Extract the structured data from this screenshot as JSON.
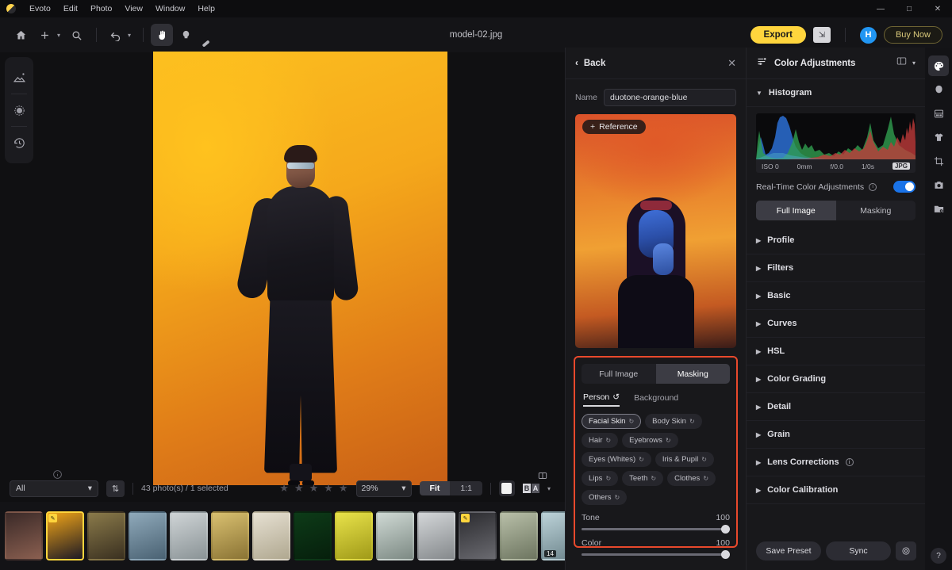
{
  "app": {
    "name": "Evoto",
    "document_title": "model-02.jpg"
  },
  "menubar": {
    "items": [
      "Evoto",
      "Edit",
      "Photo",
      "View",
      "Window",
      "Help"
    ],
    "window_controls": [
      "minimize",
      "maximize",
      "close"
    ]
  },
  "toolbar": {
    "tools": [
      {
        "name": "home-icon",
        "label": "Home"
      },
      {
        "name": "add-icon",
        "label": "Add"
      },
      {
        "name": "chevron-down-icon",
        "label": "Add options"
      },
      {
        "name": "search-icon",
        "label": "Search"
      },
      {
        "name": "undo-icon",
        "label": "Undo"
      },
      {
        "name": "chevron-down-icon",
        "label": "History"
      },
      {
        "name": "hand-icon",
        "label": "Pan",
        "active": true
      },
      {
        "name": "dodge-icon",
        "label": "Dodge"
      },
      {
        "name": "healing-brush-icon",
        "label": "Healing Brush"
      }
    ],
    "export_label": "Export",
    "share_label": "Share",
    "avatar_initial": "H",
    "buy_label": "Buy Now",
    "accent_yellow": "#ffd53d",
    "avatar_color": "#2196f3"
  },
  "left_rail": {
    "items": [
      {
        "name": "image-adjust-icon",
        "label": "Image"
      },
      {
        "name": "presets-icon",
        "label": "Presets"
      },
      {
        "name": "history-icon",
        "label": "History"
      }
    ]
  },
  "canvas": {
    "info_icon": "info-icon",
    "split_view_icon": "split-view-icon"
  },
  "bottom_bar": {
    "filter_value": "All",
    "sort_icon": "sort-icon",
    "count_text": "43 photo(s) / 1 selected",
    "stars": 5,
    "zoom_value": "29%",
    "fit_label": "Fit",
    "one_to_one_label": "1:1",
    "background_swatch": "#f2f2f2",
    "compare_icon": "before-after-icon"
  },
  "filmstrip": {
    "thumbnails": [
      {
        "c1": "#3b2a28",
        "c2": "#8a5f50",
        "selected": false,
        "edited": false
      },
      {
        "c1": "#f0a418",
        "c2": "#1d1a24",
        "selected": true,
        "edited": true
      },
      {
        "c1": "#8a7a4a",
        "c2": "#3a3020",
        "selected": false,
        "edited": false
      },
      {
        "c1": "#8fa9ba",
        "c2": "#4a6273",
        "selected": false,
        "edited": false
      },
      {
        "c1": "#cfd4d6",
        "c2": "#8a9396",
        "selected": false,
        "edited": false
      },
      {
        "c1": "#d9c070",
        "c2": "#8a7334",
        "selected": false,
        "edited": false
      },
      {
        "c1": "#e6e0d2",
        "c2": "#b0a890",
        "selected": false,
        "edited": false
      },
      {
        "c1": "#0d3b18",
        "c2": "#061f0c",
        "selected": false,
        "edited": false
      },
      {
        "c1": "#e8e24a",
        "c2": "#a09a18",
        "selected": false,
        "edited": false
      },
      {
        "c1": "#cfd9d4",
        "c2": "#7d8a84",
        "selected": false,
        "edited": false
      },
      {
        "c1": "#d3d6d8",
        "c2": "#85898c",
        "selected": false,
        "edited": false
      },
      {
        "c1": "#2b2b2f",
        "c2": "#6a6a70",
        "selected": false,
        "edited": true
      },
      {
        "c1": "#b8bfa8",
        "c2": "#6d7560",
        "selected": false,
        "edited": false
      },
      {
        "c1": "#bcd2d8",
        "c2": "#6d858c",
        "selected": false,
        "edited": false,
        "badge": "14"
      },
      {
        "c1": "#c9c3bb",
        "c2": "#7a736b",
        "selected": false,
        "edited": false
      },
      {
        "c1": "#7b3fa8",
        "c2": "#3a1c54",
        "selected": false,
        "edited": true
      }
    ]
  },
  "preset_panel": {
    "back_label": "Back",
    "close_icon": "close-icon",
    "name_label": "Name",
    "name_value": "duotone-orange-blue",
    "reference_label": "Reference",
    "mask_highlight_color": "#e8492c",
    "mode_tabs": [
      {
        "label": "Full Image",
        "active": false
      },
      {
        "label": "Masking",
        "active": true
      }
    ],
    "subject_tabs": [
      {
        "label": "Person",
        "active": true
      },
      {
        "label": "Background",
        "active": false
      }
    ],
    "chips": [
      {
        "label": "Facial Skin",
        "selected": true
      },
      {
        "label": "Body Skin",
        "selected": false
      },
      {
        "label": "Hair",
        "selected": false
      },
      {
        "label": "Eyebrows",
        "selected": false
      },
      {
        "label": "Eyes (Whites)",
        "selected": false
      },
      {
        "label": "Iris & Pupil",
        "selected": false
      },
      {
        "label": "Lips",
        "selected": false
      },
      {
        "label": "Teeth",
        "selected": false
      },
      {
        "label": "Clothes",
        "selected": false
      },
      {
        "label": "Others",
        "selected": false
      }
    ],
    "sliders": [
      {
        "label": "Tone",
        "value": "100",
        "percent": 100
      },
      {
        "label": "Color",
        "value": "100",
        "percent": 100
      }
    ]
  },
  "adjustments_panel": {
    "title": "Color Adjustments",
    "layout_icon": "panel-layout-icon",
    "chevron_icon": "chevron-down-icon",
    "histogram": {
      "label": "Histogram",
      "meta": {
        "iso": "ISO 0",
        "focal": "0mm",
        "aperture": "f/0.0",
        "shutter": "1/0s",
        "format": "JPG"
      }
    },
    "realtime": {
      "label": "Real-Time Color Adjustments",
      "enabled": true,
      "toggle_color": "#1a73e8"
    },
    "mode_tabs": [
      {
        "label": "Full Image",
        "active": true
      },
      {
        "label": "Masking",
        "active": false
      }
    ],
    "sections": [
      {
        "label": "Profile",
        "info": false
      },
      {
        "label": "Filters",
        "info": false
      },
      {
        "label": "Basic",
        "info": false
      },
      {
        "label": "Curves",
        "info": false
      },
      {
        "label": "HSL",
        "info": false
      },
      {
        "label": "Color Grading",
        "info": false
      },
      {
        "label": "Detail",
        "info": false
      },
      {
        "label": "Grain",
        "info": false
      },
      {
        "label": "Lens Corrections",
        "info": true
      },
      {
        "label": "Color Calibration",
        "info": false
      }
    ],
    "footer": {
      "save_preset_label": "Save Preset",
      "sync_label": "Sync",
      "settings_icon": "gear-icon"
    }
  },
  "right_rail": {
    "items": [
      {
        "name": "palette-icon",
        "label": "Color",
        "active": true
      },
      {
        "name": "face-icon",
        "label": "Retouch"
      },
      {
        "name": "texture-icon",
        "label": "Texture"
      },
      {
        "name": "clothes-icon",
        "label": "Clothes"
      },
      {
        "name": "crop-icon",
        "label": "Crop"
      },
      {
        "name": "camera-icon",
        "label": "Camera"
      },
      {
        "name": "folder-icon",
        "label": "Folder"
      }
    ],
    "help_label": "?"
  }
}
